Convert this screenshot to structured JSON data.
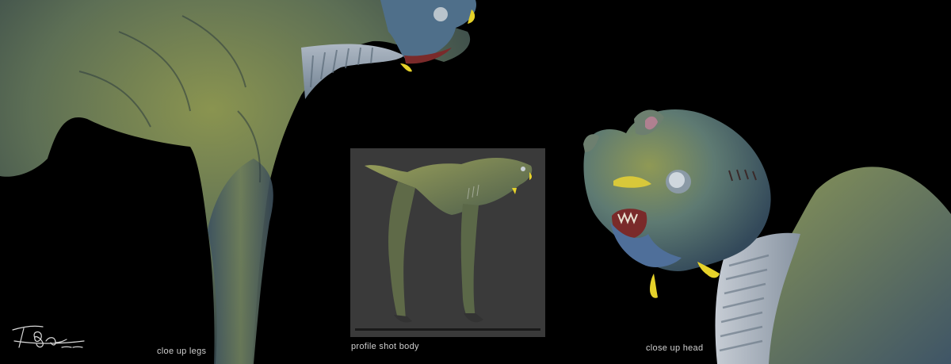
{
  "captions": {
    "legs": "cloe up legs",
    "profile": "profile shot body",
    "head": "close up head"
  },
  "colors": {
    "background": "#000000",
    "skin_green": "#6f7f45",
    "skin_blue": "#4f6f8a",
    "accent_yellow": "#e6d22a",
    "mouth_red": "#7a2a2a"
  }
}
